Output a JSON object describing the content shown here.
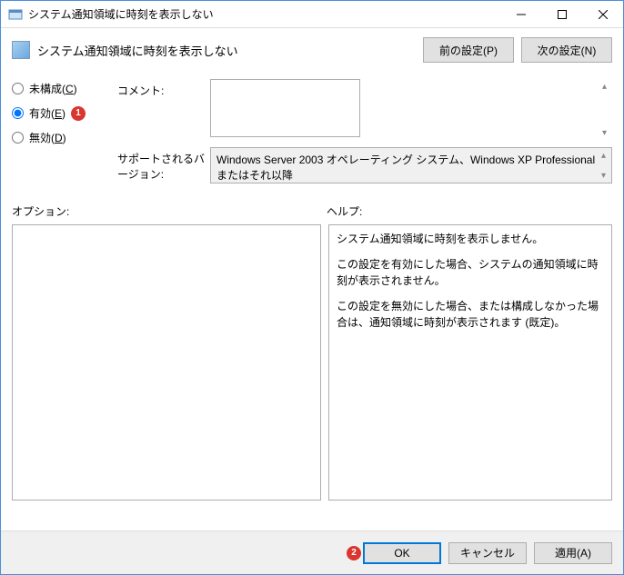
{
  "titlebar": {
    "title": "システム通知領域に時刻を表示しない"
  },
  "header": {
    "title": "システム通知領域に時刻を表示しない",
    "prev_btn": "前の設定(P)",
    "next_btn": "次の設定(N)"
  },
  "radios": {
    "not_configured": "未構成(",
    "not_configured_key": "C",
    "enabled": "有効(",
    "enabled_key": "E",
    "disabled": "無効(",
    "disabled_key": "D",
    "close_paren": ")"
  },
  "badges": {
    "b1": "1",
    "b2": "2"
  },
  "comment": {
    "label": "コメント:"
  },
  "support": {
    "label": "サポートされるバージョン:",
    "text": "Windows Server 2003 オペレーティング システム、Windows XP Professional またはそれ以降"
  },
  "sections": {
    "options": "オプション:",
    "help": "ヘルプ:"
  },
  "help": {
    "p1": "システム通知領域に時刻を表示しません。",
    "p2": "この設定を有効にした場合、システムの通知領域に時刻が表示されません。",
    "p3": "この設定を無効にした場合、または構成しなかった場合は、通知領域に時刻が表示されます (既定)。"
  },
  "footer": {
    "ok": "OK",
    "cancel": "キャンセル",
    "apply": "適用(A)"
  }
}
